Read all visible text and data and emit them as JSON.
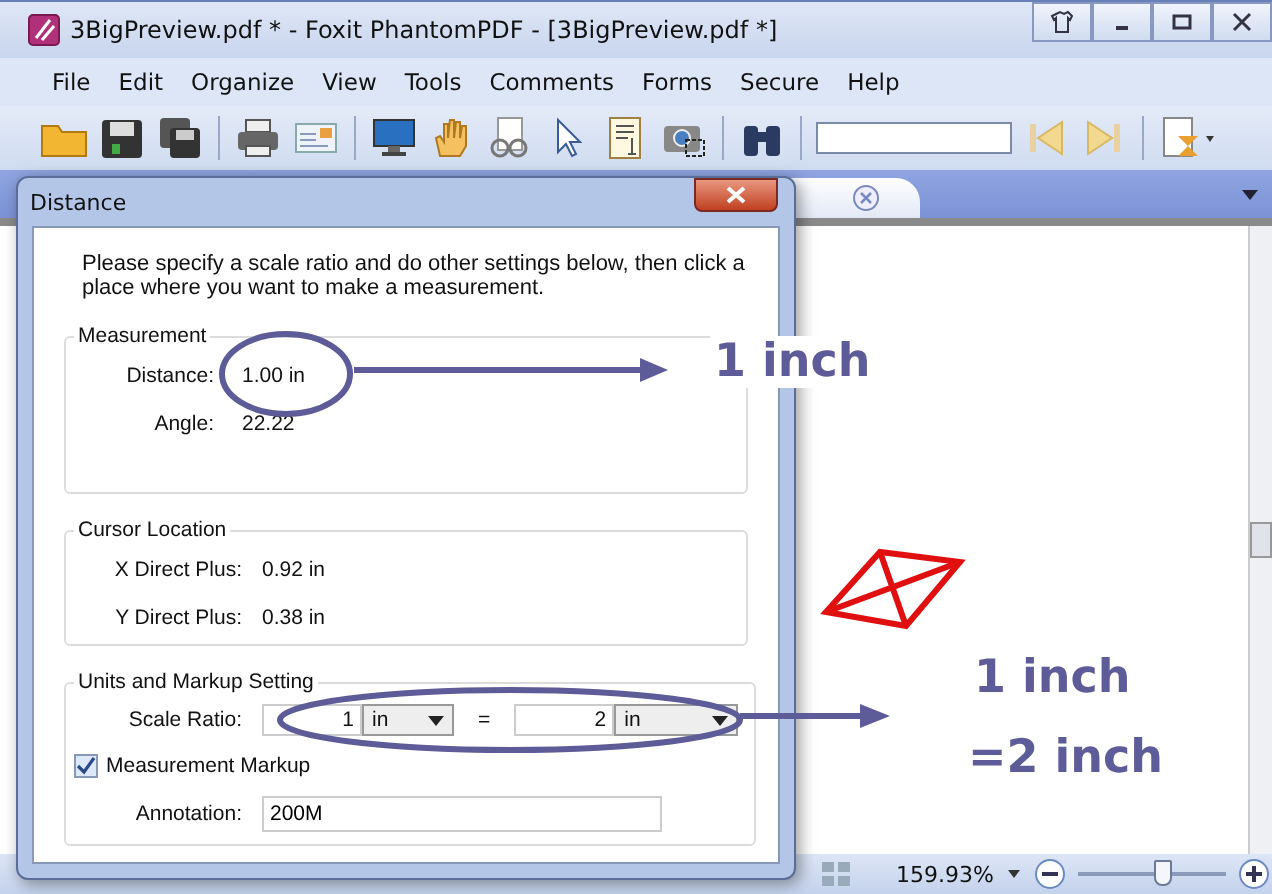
{
  "window": {
    "title": "3BigPreview.pdf * - Foxit PhantomPDF - [3BigPreview.pdf *]"
  },
  "menu": [
    "File",
    "Edit",
    "Organize",
    "View",
    "Tools",
    "Comments",
    "Forms",
    "Secure",
    "Help"
  ],
  "dialog": {
    "title": "Distance",
    "instructions": "Please specify a scale ratio and do other settings below, then click a place where you want to make a measurement.",
    "measurement": {
      "title": "Measurement",
      "rows": [
        {
          "label": "Distance:",
          "value": "1.00 in"
        },
        {
          "label": "Angle:",
          "value": "22.22"
        }
      ]
    },
    "cursor_location": {
      "title": "Cursor Location",
      "rows": [
        {
          "label": "X Direct Plus:",
          "value": "0.92 in"
        },
        {
          "label": "Y Direct Plus:",
          "value": "0.38 in"
        }
      ]
    },
    "units": {
      "title": "Units and Markup Setting",
      "scale_label": "Scale Ratio:",
      "left": {
        "value": "1",
        "unit": "in"
      },
      "equals": "=",
      "right": {
        "value": "2",
        "unit": "in"
      },
      "markup": {
        "label": "Measurement Markup",
        "checked": true
      },
      "annotation": {
        "label": "Annotation:",
        "value": "200M"
      }
    }
  },
  "callouts": [
    {
      "text": "1 inch"
    },
    {
      "text": "1 inch"
    },
    {
      "text": "=2 inch"
    }
  ],
  "status_bar": {
    "zoom": "159.93%",
    "zoom_slider": {
      "level": 0.58
    }
  }
}
